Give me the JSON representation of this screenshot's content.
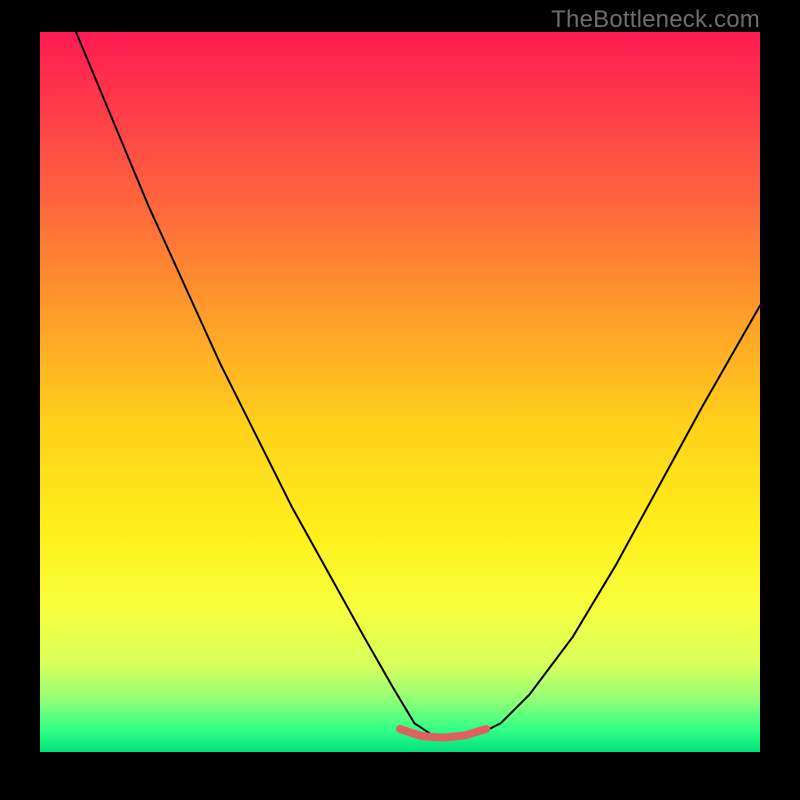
{
  "watermark": "TheBottleneck.com",
  "chart_data": {
    "type": "line",
    "title": "",
    "xlabel": "",
    "ylabel": "",
    "xlim": [
      0,
      100
    ],
    "ylim": [
      0,
      100
    ],
    "series": [
      {
        "name": "bottleneck-curve",
        "color": "#000000",
        "stroke_width": 2,
        "x": [
          5,
          10,
          15,
          20,
          25,
          30,
          35,
          40,
          45,
          49,
          52,
          55,
          58,
          61,
          64,
          68,
          74,
          80,
          86,
          92,
          100
        ],
        "y": [
          100,
          88,
          76,
          65,
          54,
          44,
          34,
          25,
          16,
          9,
          4,
          2,
          2,
          2.5,
          4,
          8,
          16,
          26,
          37,
          48,
          62
        ]
      },
      {
        "name": "highlight-segment",
        "color": "#e06060",
        "stroke_width": 8,
        "x": [
          50,
          53,
          56,
          59,
          62
        ],
        "y": [
          3.2,
          2.2,
          2.0,
          2.3,
          3.2
        ]
      }
    ]
  }
}
